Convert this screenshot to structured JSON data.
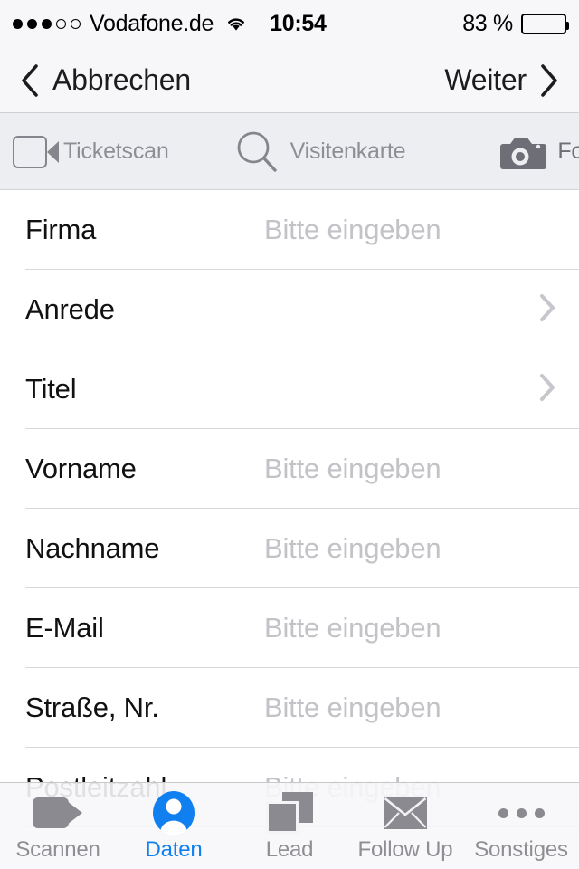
{
  "statusbar": {
    "signal_filled": 3,
    "signal_empty": 2,
    "carrier": "Vodafone.de",
    "wifi_icon": "wifi-icon",
    "time": "10:54",
    "battery_pct": "83 %",
    "battery_level": 83
  },
  "navbar": {
    "back_label": "Abbrechen",
    "back_icon": "chevron-left-icon",
    "forward_label": "Weiter",
    "forward_icon": "chevron-right-icon"
  },
  "scanbar": {
    "items": [
      {
        "label": "Ticketscan",
        "icon": "ticket-icon"
      },
      {
        "label": "Visitenkarte",
        "icon": "magnifier-icon"
      },
      {
        "label": "Foto",
        "icon": "camera-icon"
      }
    ]
  },
  "form": {
    "placeholder": "Bitte eingeben",
    "rows": [
      {
        "label": "Firma",
        "value": "Bitte eingeben",
        "type": "input"
      },
      {
        "label": "Anrede",
        "value": "",
        "type": "disclosure"
      },
      {
        "label": "Titel",
        "value": "",
        "type": "disclosure"
      },
      {
        "label": "Vorname",
        "value": "Bitte eingeben",
        "type": "input"
      },
      {
        "label": "Nachname",
        "value": "Bitte eingeben",
        "type": "input"
      },
      {
        "label": "E-Mail",
        "value": "Bitte eingeben",
        "type": "input"
      },
      {
        "label": "Straße, Nr.",
        "value": "Bitte eingeben",
        "type": "input"
      },
      {
        "label": "Postleitzahl",
        "value": "Bitte eingeben",
        "type": "input"
      }
    ]
  },
  "tabbar": {
    "active_color": "#1080f0",
    "inactive_color": "#8e8e93",
    "tabs": [
      {
        "label": "Scannen",
        "icon": "video-camera-icon",
        "active": false
      },
      {
        "label": "Daten",
        "icon": "contact-person-icon",
        "active": true
      },
      {
        "label": "Lead",
        "icon": "stacked-pages-icon",
        "active": false
      },
      {
        "label": "Follow Up",
        "icon": "envelope-icon",
        "active": false
      },
      {
        "label": "Sonstiges",
        "icon": "more-dots-icon",
        "active": false
      }
    ]
  }
}
